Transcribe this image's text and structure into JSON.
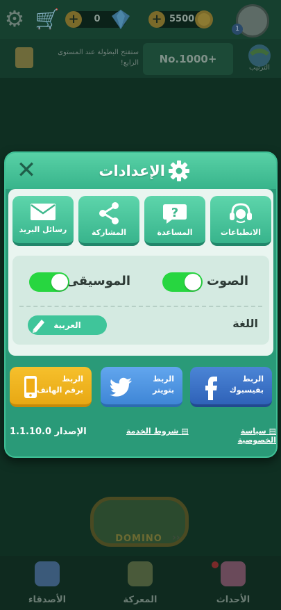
{
  "topbar": {
    "gems_value": "0",
    "coins_value": "5500",
    "level": "1"
  },
  "banner": {
    "tournament_text": "ستفتح البطولة عند المستوى الرابع!",
    "rank_value": "No.1000+",
    "rank_label": "الترتيب"
  },
  "game": {
    "title": "DOMINO"
  },
  "nav": {
    "friends": "الأصدقاء",
    "battle": "المعركة",
    "events": "الأحداث"
  },
  "settings": {
    "title": "الإعدادات",
    "tiles": [
      {
        "label": "الانطباعات",
        "icon": "headset-icon"
      },
      {
        "label": "المساعدة",
        "icon": "help-icon"
      },
      {
        "label": "المشاركة",
        "icon": "share-icon"
      },
      {
        "label": "رسائل البريد",
        "icon": "mail-icon"
      }
    ],
    "sound_label": "الصوت",
    "music_label": "الموسيقى",
    "language_label": "اللغة",
    "language_value": "العربية",
    "link_facebook": "الربط\nبفيسبوك",
    "link_facebook_1": "الربط",
    "link_facebook_2": "بفيسبوك",
    "link_twitter_1": "الربط",
    "link_twitter_2": "بتويتر",
    "link_phone_1": "الربط",
    "link_phone_2": "برقم الهاتف",
    "version": "الإصدار 1.1.10.0",
    "terms": "شروط الخدمة",
    "privacy": "سياسة الخصوصية"
  },
  "colors": {
    "dialog": "#2a9a78",
    "toggle_on": "#27d640",
    "facebook": "#3b70c9",
    "twitter": "#4f93dd",
    "phone": "#f0b21a"
  }
}
